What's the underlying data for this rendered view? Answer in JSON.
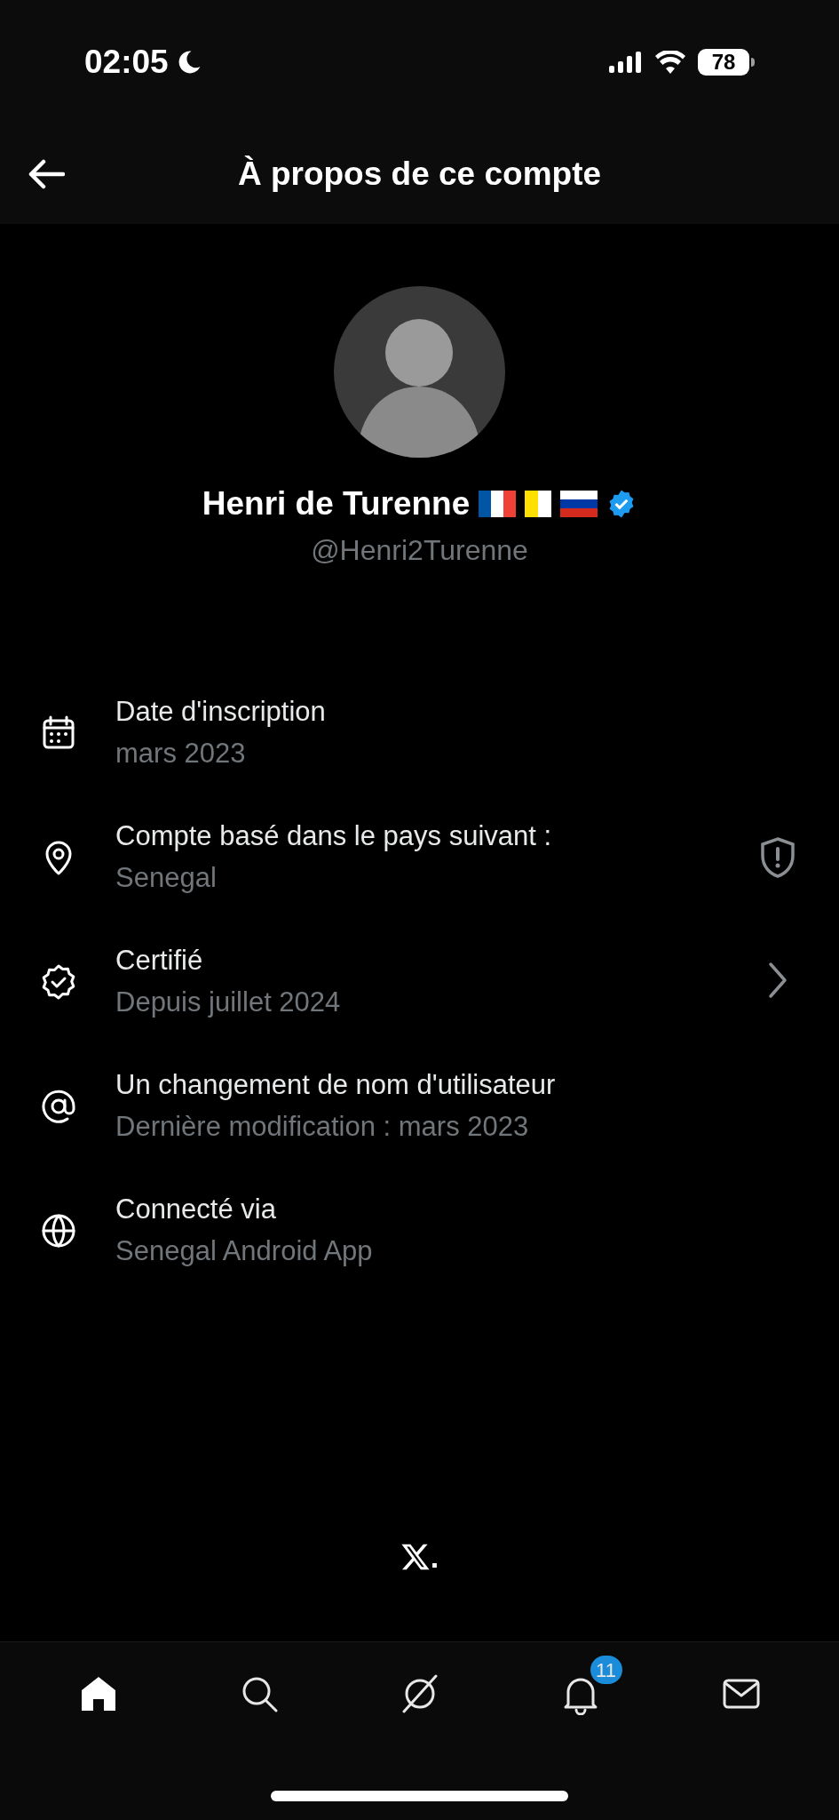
{
  "status_bar": {
    "time": "02:05",
    "battery": "78"
  },
  "header": {
    "title": "À propos de ce compte"
  },
  "profile": {
    "name": "Henri de Turenne",
    "handle": "@Henri2Turenne",
    "verified": true
  },
  "details": [
    {
      "kind": "calendar",
      "title": "Date d'inscription",
      "value": "mars 2023"
    },
    {
      "kind": "location",
      "title": "Compte basé dans le pays suivant :",
      "value": "Senegal",
      "trailing": {
        "kind": "shield"
      }
    },
    {
      "kind": "verified",
      "title": "Certifié",
      "value": "Depuis juillet 2024",
      "trailing": {
        "kind": "chevron"
      }
    },
    {
      "kind": "at",
      "title": "Un changement de nom d'utilisateur",
      "value": "Dernière modification : mars 2023"
    },
    {
      "kind": "globe",
      "title": "Connecté via",
      "value": "Senegal Android App"
    }
  ],
  "footer": {
    "logo_suffix": "."
  },
  "tab_bar": [
    {
      "kind": "home",
      "selected": true
    },
    {
      "kind": "search",
      "selected": false
    },
    {
      "kind": "grok",
      "selected": false
    },
    {
      "kind": "bell",
      "selected": false,
      "badge": "11"
    },
    {
      "kind": "mail",
      "selected": false
    }
  ]
}
